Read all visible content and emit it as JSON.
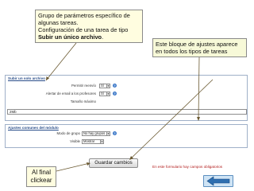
{
  "callouts": {
    "top_line1": "Grupo de parámetros específico de",
    "top_line2": "algunas tareas.",
    "top_line3": "Configuración de una tarea de tipo",
    "top_bold": "Subir un único archivo",
    "top_end": ".",
    "right_line1": "Este bloque de ajustes  aparece",
    "right_line2": "en todos los tipos de tareas",
    "bottom_line1": "Al final",
    "bottom_line2": "clickear"
  },
  "form": {
    "section1_title": "Subir un solo archivo",
    "rows": [
      {
        "label": "Permitir reenvío",
        "value": "Sí"
      },
      {
        "label": "Alertar de email a los profesores",
        "value": "Sí"
      },
      {
        "label": "Tamaño máximo",
        "value": ""
      }
    ],
    "max_size_value": "2Mb",
    "section2_title": "Ajustes comunes del módulo",
    "group_mode_label": "Modo de grupo",
    "group_mode_value": "No hay grupos",
    "visible_label": "Visible",
    "visible_value": "Mostrar",
    "save_button": "Guardar cambios",
    "required_note": "En este formulario hay campos obligatorios"
  },
  "icons": {
    "help": "help-icon",
    "dropdown": "dropdown-arrow-icon",
    "nav": "left-arrow-icon"
  },
  "colors": {
    "callout_fill": "#fffde0",
    "nav_button_fill": "#cfe4f5",
    "panel_border": "#9fb0c8",
    "section_title": "#2a4e8a"
  }
}
